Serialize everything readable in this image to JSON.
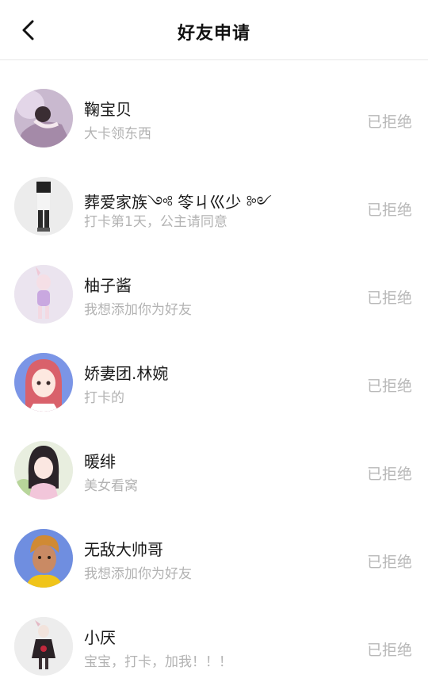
{
  "header": {
    "title": "好友申请",
    "back_icon": "chevron-left-icon"
  },
  "requests": [
    {
      "name": "鞠宝贝",
      "message": "大卡领东西",
      "status": "已拒绝"
    },
    {
      "name": "葬爱家族༺ 笭ㄐ巛少 ༻",
      "message": "打卡第1天，公主请同意",
      "status": "已拒绝"
    },
    {
      "name": "柚子酱",
      "message": "我想添加你为好友",
      "status": "已拒绝"
    },
    {
      "name": "娇妻团.林婉",
      "message": "打卡的",
      "status": "已拒绝"
    },
    {
      "name": "暖绯",
      "message": "美女看窝",
      "status": "已拒绝"
    },
    {
      "name": "无敌大帅哥",
      "message": "我想添加你为好友",
      "status": "已拒绝"
    },
    {
      "name": "小厌",
      "message": "宝宝，打卡，加我！！！",
      "status": "已拒绝"
    }
  ]
}
